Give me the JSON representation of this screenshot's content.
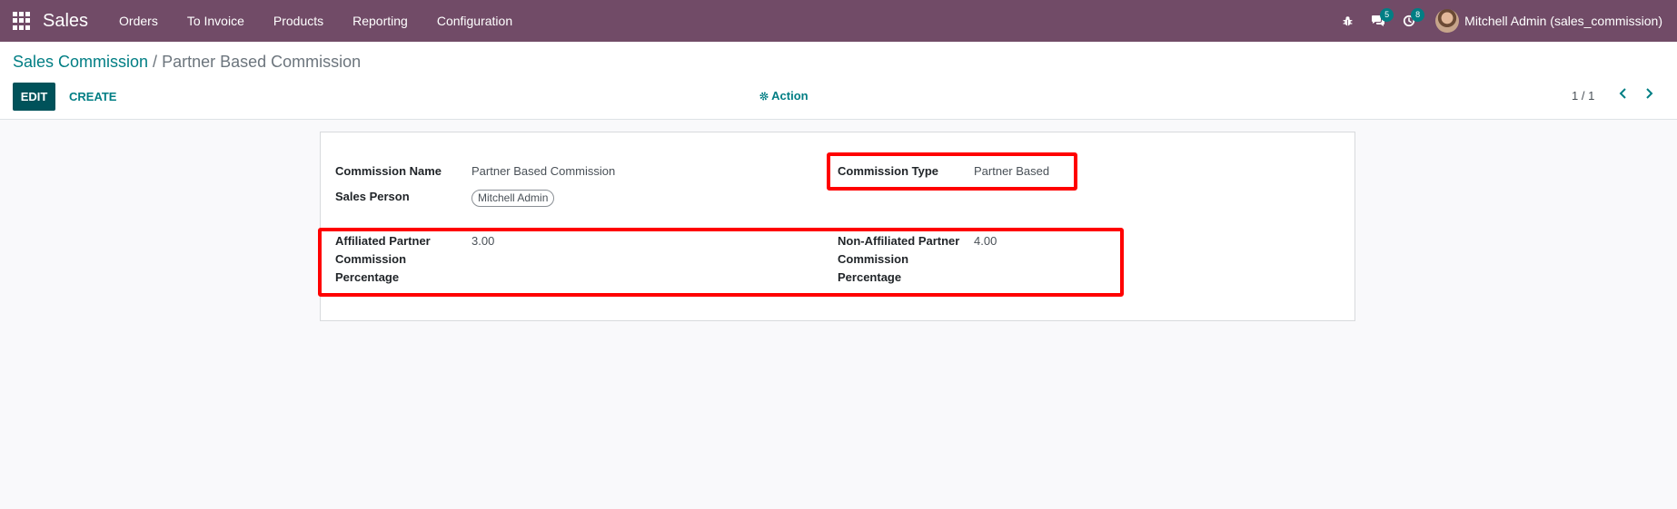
{
  "navbar": {
    "app_name": "Sales",
    "menu": [
      "Orders",
      "To Invoice",
      "Products",
      "Reporting",
      "Configuration"
    ],
    "chat_badge": "5",
    "activity_badge": "8",
    "user": "Mitchell Admin (sales_commission)",
    "color": "#714b67"
  },
  "breadcrumb": {
    "parent": "Sales Commission",
    "separator": " / ",
    "current": "Partner Based Commission"
  },
  "toolbar": {
    "edit_label": "EDIT",
    "create_label": "CREATE",
    "action_label": "Action",
    "pager": "1 / 1"
  },
  "form": {
    "commission_name_label": "Commission Name",
    "commission_name_value": "Partner Based Commission",
    "sales_person_label": "Sales Person",
    "sales_person_value": "Mitchell Admin",
    "commission_type_label": "Commission Type",
    "commission_type_value": "Partner Based",
    "affiliated_label_1": "Affiliated Partner",
    "affiliated_label_2": "Commission",
    "affiliated_label_3": "Percentage",
    "affiliated_value": "3.00",
    "non_affiliated_label_1": "Non-Affiliated Partner",
    "non_affiliated_label_2": "Commission",
    "non_affiliated_label_3": "Percentage",
    "non_affiliated_value": "4.00"
  }
}
